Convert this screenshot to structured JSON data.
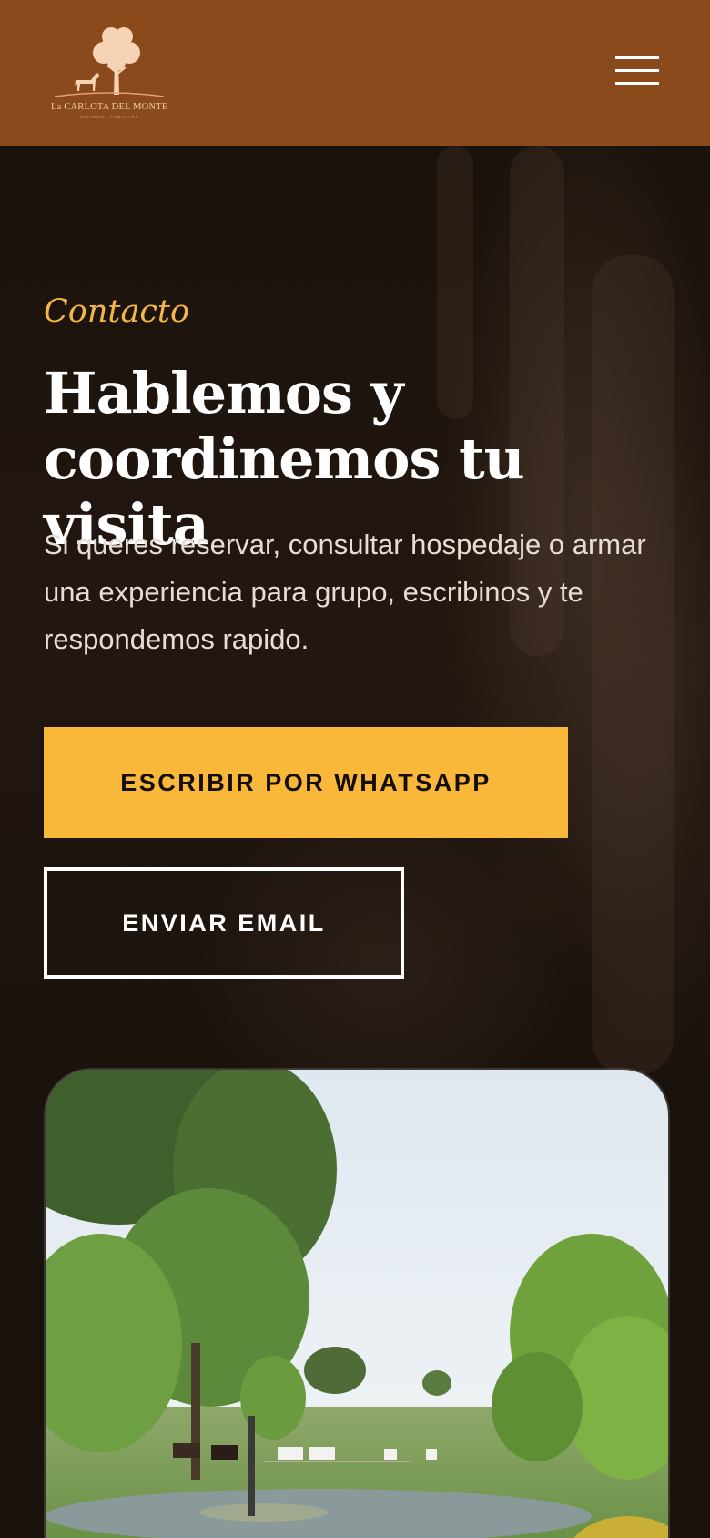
{
  "header": {
    "logo": {
      "icon": "horse-and-tree-logo",
      "name": "La CARLOTA DEL MONTE",
      "tagline": "HACIENDA CABALLOS"
    },
    "menu_icon": "hamburger-menu-icon"
  },
  "hero": {
    "kicker": "Contacto",
    "title": "Hablemos y coordinemos tu visita",
    "description": "Si queres reservar, consultar hospedaje o armar una experiencia para grupo, escribinos y te respondemos rapido.",
    "whatsapp_button": "ESCRIBIR POR WHATSAPP",
    "email_button": "ENVIAR EMAIL"
  },
  "colors": {
    "header_bg": "#8a4a1c",
    "accent": "#f9b83a",
    "kicker": "#f3b648",
    "page_bg": "#140e0a"
  }
}
